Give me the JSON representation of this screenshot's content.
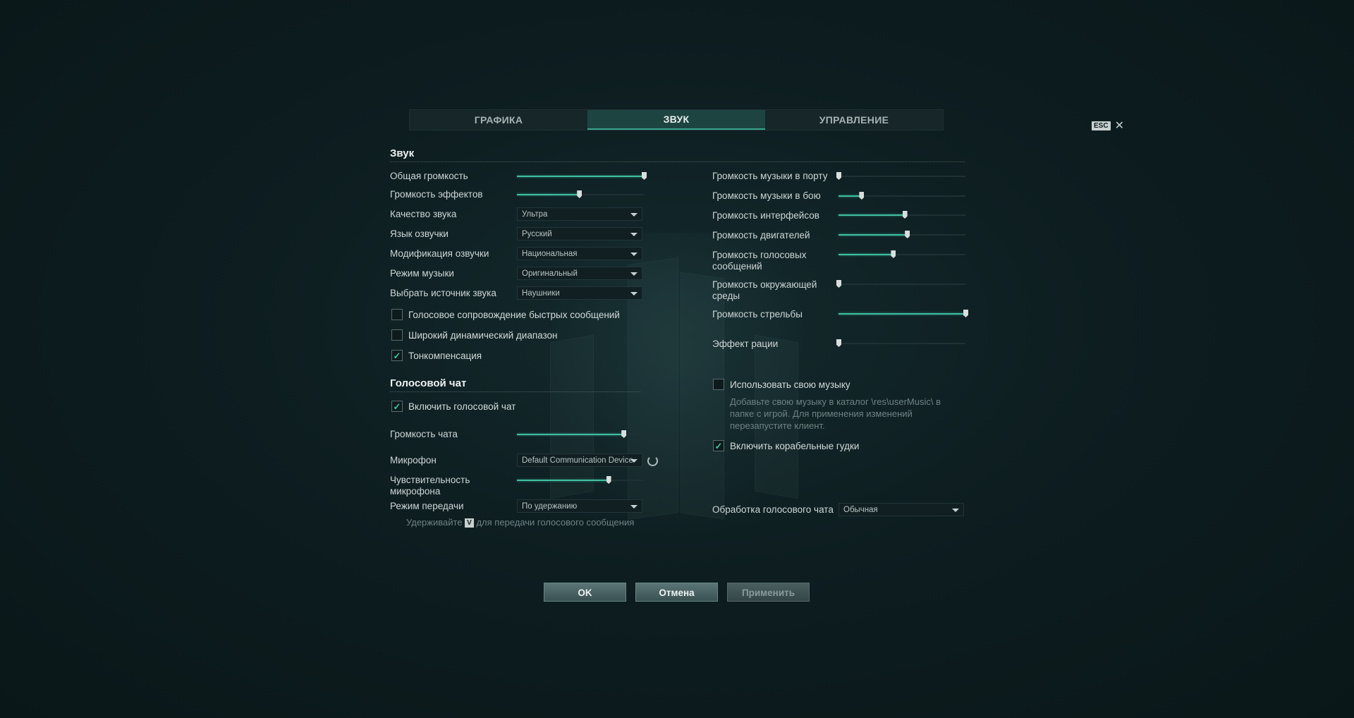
{
  "tabs": [
    {
      "label": "ГРАФИКА"
    },
    {
      "label": "ЗВУК"
    },
    {
      "label": "УПРАВЛЕНИЕ"
    }
  ],
  "esc": {
    "key": "ESC",
    "close": "✕"
  },
  "sound": {
    "title": "Звук",
    "master_volume": {
      "label": "Общая громкость",
      "value": 1.0
    },
    "effects_volume": {
      "label": "Громкость эффектов",
      "value": 0.49
    },
    "quality": {
      "label": "Качество звука",
      "value": "Ультра"
    },
    "voice_language": {
      "label": "Язык озвучки",
      "value": "Русский"
    },
    "voice_mod": {
      "label": "Модификация озвучки",
      "value": "Национальная"
    },
    "music_mode": {
      "label": "Режим музыки",
      "value": "Оригинальный"
    },
    "source": {
      "label": "Выбрать источник звука",
      "value": "Наушники"
    },
    "cb_quick_messages": {
      "label": "Голосовое сопровождение быстрых сообщений",
      "checked": false
    },
    "cb_dynamic_range": {
      "label": "Широкий динамический диапазон",
      "checked": false
    },
    "cb_tone_comp": {
      "label": "Тонкомпенсация",
      "checked": true
    }
  },
  "voice_chat": {
    "title": "Голосовой чат",
    "cb_enable": {
      "label": "Включить голосовой чат",
      "checked": true
    },
    "chat_volume": {
      "label": "Громкость чата",
      "value": 0.84
    },
    "microphone": {
      "label": "Микрофон",
      "value": "Default Communication Device"
    },
    "mic_sensitivity": {
      "label": "Чувствительность микрофона",
      "value": 0.72
    },
    "transmit_mode": {
      "label": "Режим передачи",
      "value": "По удержанию"
    },
    "hint_pre": "Удерживайте",
    "hint_key": "V",
    "hint_post": "для передачи голосового сообщения"
  },
  "right": {
    "music_port": {
      "label": "Громкость музыки в порту",
      "value": 0.0
    },
    "music_battle": {
      "label": "Громкость музыки в бою",
      "value": 0.18
    },
    "interface": {
      "label": "Громкость интерфейсов",
      "value": 0.52
    },
    "engines": {
      "label": "Громкость двигателей",
      "value": 0.54
    },
    "voice_msgs": {
      "label": "Громкость голосовых сообщений",
      "value": 0.43
    },
    "ambient": {
      "label": "Громкость окружающей среды",
      "value": 0.0
    },
    "shooting": {
      "label": "Громкость стрельбы",
      "value": 1.0
    },
    "radio": {
      "label": "Эффект рации",
      "value": 0.0
    },
    "cb_own_music": {
      "label": "Использовать свою музыку",
      "checked": false
    },
    "own_music_hint": "Добавьте свою музыку в каталог \\res\\userMusic\\ в папке с игрой. Для применения изменений перезапустите клиент.",
    "cb_horns": {
      "label": "Включить корабельные гудки",
      "checked": true
    },
    "voice_processing": {
      "label": "Обработка голосового чата",
      "value": "Обычная"
    }
  },
  "buttons": {
    "ok": "OK",
    "cancel": "Отмена",
    "apply": "Применить"
  },
  "colors": {
    "accent": "#3fbfa1",
    "background": "#0d1d20"
  }
}
